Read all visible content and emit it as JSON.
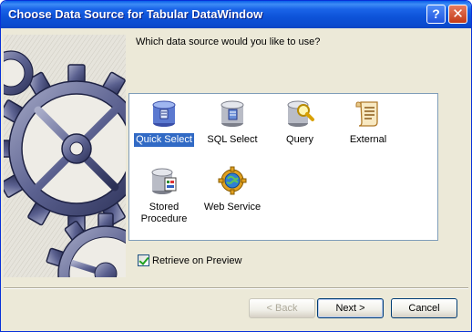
{
  "window": {
    "title": "Choose Data Source for Tabular DataWindow",
    "help_glyph": "?",
    "close_glyph": "✕"
  },
  "prompt": "Which data source would you like to use?",
  "sources": [
    {
      "label": "Quick Select",
      "icon": "quick-select-icon",
      "selected": true
    },
    {
      "label": "SQL Select",
      "icon": "sql-select-icon",
      "selected": false
    },
    {
      "label": "Query",
      "icon": "query-icon",
      "selected": false
    },
    {
      "label": "External",
      "icon": "external-icon",
      "selected": false
    },
    {
      "label": "Stored\nProcedure",
      "icon": "stored-procedure-icon",
      "selected": false
    },
    {
      "label": "Web Service",
      "icon": "web-service-icon",
      "selected": false
    }
  ],
  "options": {
    "retrieve_on_preview": {
      "label": "Retrieve on Preview",
      "checked": true
    }
  },
  "buttons": {
    "back": "< Back",
    "next": "Next >",
    "cancel": "Cancel"
  },
  "colors": {
    "titlebar": "#0b4cd0",
    "selection": "#316ac5",
    "dialog_bg": "#ece9d8"
  }
}
